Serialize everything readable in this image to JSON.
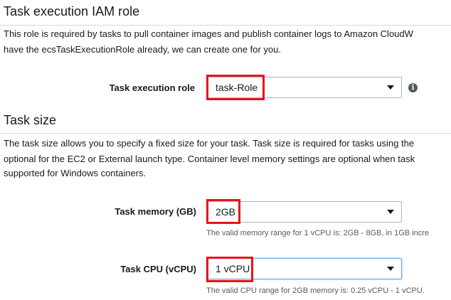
{
  "iam_section": {
    "title": "Task execution IAM role",
    "description_line1": "This role is required by tasks to pull container images and publish container logs to Amazon CloudW",
    "description_line2": "have the ecsTaskExecutionRole already, we can create one for you.",
    "execution_role_label": "Task execution role",
    "execution_role_value": "task-Role",
    "info_icon": "info-icon"
  },
  "size_section": {
    "title": "Task size",
    "description_line1": "The task size allows you to specify a fixed size for your task. Task size is required for tasks using the",
    "description_line2": "optional for the EC2 or External launch type. Container level memory settings are optional when task",
    "description_line3": "supported for Windows containers.",
    "memory_label": "Task memory (GB)",
    "memory_value": "2GB",
    "memory_hint": "The valid memory range for 1 vCPU is: 2GB - 8GB, in 1GB incre",
    "cpu_label": "Task CPU (vCPU)",
    "cpu_value": "1 vCPU",
    "cpu_hint": "The valid CPU range for 2GB memory is: 0.25 vCPU - 1 vCPU."
  },
  "colors": {
    "highlight": "#e8131c",
    "focus_border": "#6ea4d8"
  }
}
